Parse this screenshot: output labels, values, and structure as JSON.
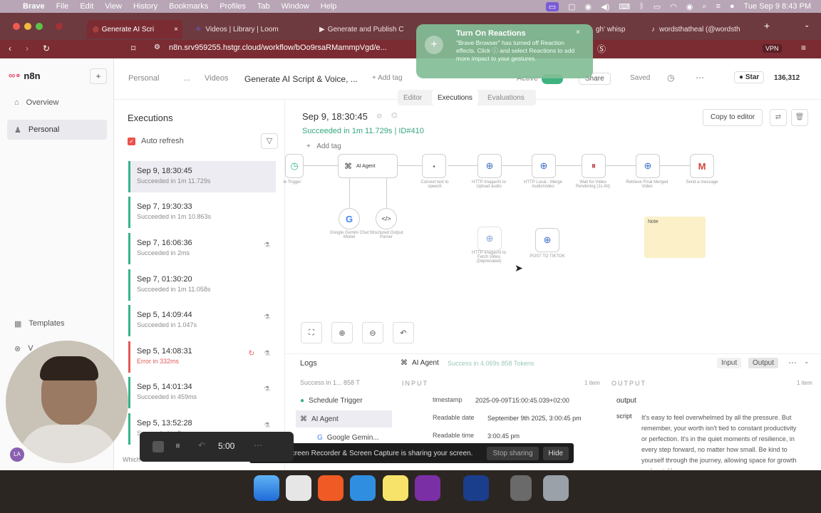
{
  "menubar": {
    "items": [
      "Brave",
      "File",
      "Edit",
      "View",
      "History",
      "Bookmarks",
      "Profiles",
      "Tab",
      "Window",
      "Help"
    ],
    "clock": "Tue Sep 9  8:43 PM"
  },
  "tabs": [
    {
      "label": "Generate AI Scri"
    },
    {
      "label": "Videos | Library | Loom"
    },
    {
      "label": "Generate and Publish C"
    },
    {
      "label": "gh' whisp"
    },
    {
      "label": "wordsthatheal (@wordsth"
    }
  ],
  "address": {
    "url": "n8n.srv959255.hstgr.cloud/workflow/bOo9rsaRMammpVgd/e..."
  },
  "notification": {
    "title": "Turn On Reactions",
    "body": "\"Brave Browser\" has turned off Reaction effects. Click ⓘ and select Reactions to add more impact to your gestures."
  },
  "sidebar": {
    "brand": "n8n",
    "items": [
      {
        "label": "Overview"
      },
      {
        "label": "Personal"
      },
      {
        "label": "Templates"
      },
      {
        "label": "V"
      }
    ]
  },
  "header": {
    "crumb_personal": "Personal",
    "crumb_ellipsis": "...",
    "crumb_videos": "Videos",
    "title": "Generate AI Script & Voice, ...",
    "add_tag": "+ Add tag",
    "active_label": "Active",
    "share": "Share",
    "saved": "Saved",
    "star": "Star",
    "star_count": "136,312",
    "tab_editor": "Editor",
    "tab_executions": "Executions",
    "tab_evaluations": "Evaluations"
  },
  "executions": {
    "title": "Executions",
    "auto_refresh": "Auto refresh",
    "items": [
      {
        "date": "Sep 9, 18:30:45",
        "status": "Succeeded in 1m 11.729s"
      },
      {
        "date": "Sep 7, 19:30:33",
        "status": "Succeeded in 1m 10.863s"
      },
      {
        "date": "Sep 7, 16:06:36",
        "status": "Succeeded in 2ms"
      },
      {
        "date": "Sep 7, 01:30:20",
        "status": "Succeeded in 1m 11.058s"
      },
      {
        "date": "Sep 5, 14:09:44",
        "status": "Succeeded in 1.047s"
      },
      {
        "date": "Sep 5, 14:08:31",
        "status": "Error in 332ms"
      },
      {
        "date": "Sep 5, 14:01:34",
        "status": "Succeeded in 459ms"
      },
      {
        "date": "Sep 5, 13:52:28",
        "status": "Succeeded in 2ms"
      }
    ]
  },
  "detail": {
    "date": "Sep 9, 18:30:45",
    "status": "Succeeded in 1m 11.729s | ID#410",
    "add_tag": "Add tag",
    "copy_to_editor": "Copy to editor"
  },
  "nodes": [
    {
      "label": "le Trigger"
    },
    {
      "label": "AI Agent"
    },
    {
      "label": "Convert text to speech"
    },
    {
      "label": "HTTP Image/AI to Upload audio"
    },
    {
      "label": "HTTP Local - Merge Audio/video"
    },
    {
      "label": "Wait for Video Rendering (1s Alt)"
    },
    {
      "label": "Retrieve Final Merged Video"
    },
    {
      "label": "Send a message"
    },
    {
      "label": "Google Gemini Chat Model"
    },
    {
      "label": "Structured Output Parser"
    },
    {
      "label": "HTTP Image/AI to Fetch Video (Deprecated)"
    },
    {
      "label": "POST TO TIKTOK"
    },
    {
      "label": "Note"
    }
  ],
  "logs": {
    "title": "Logs",
    "summary": "Success in 1...  858 T",
    "node_title": "AI Agent",
    "node_summary": "Success in 4.069s  858 Tokens",
    "input_btn": "Input",
    "output_btn": "Output",
    "input_header": "INPUT",
    "input_count": "1 item",
    "output_header": "OUTPUT",
    "output_count": "1 item",
    "tree": [
      {
        "label": "Schedule Trigger"
      },
      {
        "label": "AI Agent"
      },
      {
        "label": "Google Gemin..."
      }
    ],
    "fields": [
      {
        "key": "timestamp",
        "value": "2025-09-09T15:00:45.039+02:00"
      },
      {
        "key": "Readable date",
        "value": "September 9th 2025, 3:00:45 pm"
      },
      {
        "key": "Readable time",
        "value": "3:00:45 pm"
      }
    ],
    "output_key": "output",
    "script_key": "script",
    "script_value": "It's easy to feel overwhelmed by all the pressure. But remember, your worth isn't tied to constant productivity or perfection. It's in the quiet moments of resilience, in every step forward, no matter how small. Be kind to yourself through the journey, allowing space for growth and rest. You are"
  },
  "loom": {
    "message": "Loom – Screen Recorder & Screen Capture is sharing your screen.",
    "stop": "Stop sharing",
    "hide": "Hide",
    "timer": "5:00"
  },
  "footer": {
    "hint": "Which executions is this workflow sa..."
  }
}
